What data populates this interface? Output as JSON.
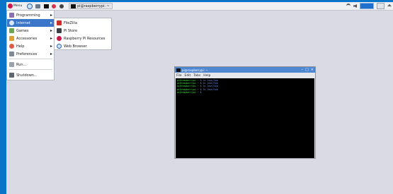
{
  "taskbar": {
    "menu_label": "Menu",
    "task_label": "pi@raspberrypi: ~",
    "icons": [
      "raspberry-icon",
      "globe-icon",
      "folder-icon",
      "terminal-icon",
      "wolfram-icon",
      "mathematica-icon"
    ]
  },
  "start_menu": {
    "items": [
      {
        "label": "Programming",
        "has_submenu": true
      },
      {
        "label": "Internet",
        "has_submenu": true,
        "selected": true
      },
      {
        "label": "Games",
        "has_submenu": true
      },
      {
        "label": "Accessories",
        "has_submenu": true
      },
      {
        "label": "Help",
        "has_submenu": true
      },
      {
        "label": "Preferences",
        "has_submenu": true
      },
      {
        "label": "Run...",
        "has_submenu": false
      },
      {
        "label": "Shutdown...",
        "has_submenu": false
      }
    ]
  },
  "submenu": {
    "items": [
      {
        "label": "FileZilla"
      },
      {
        "label": "Pi Store"
      },
      {
        "label": "Raspberry Pi Resources"
      },
      {
        "label": "Web Browser"
      }
    ]
  },
  "terminal": {
    "title": "pi@raspberrypi: ~",
    "menus": [
      "File",
      "Edit",
      "Tabs",
      "Help"
    ],
    "lines": [
      {
        "prompt": "pi@raspberrypi",
        "cmd": "~ $ ls /usr/lib"
      },
      {
        "prompt": "pi@raspberrypi",
        "cmd": "~ $ ls /usr/lib"
      },
      {
        "prompt": "pi@raspberrypi",
        "cmd": "~ $ ls /usr/lib"
      },
      {
        "prompt": "pi@raspberrypi",
        "cmd": "~ $ ls /usr/lib"
      },
      {
        "prompt": "pi@raspberrypi",
        "cmd": "~ $"
      }
    ]
  },
  "colors": {
    "accent": "#3b76c8",
    "desktop": "#d9dae4",
    "frame": "#0a74c8",
    "prompt": "#4ade4a"
  }
}
